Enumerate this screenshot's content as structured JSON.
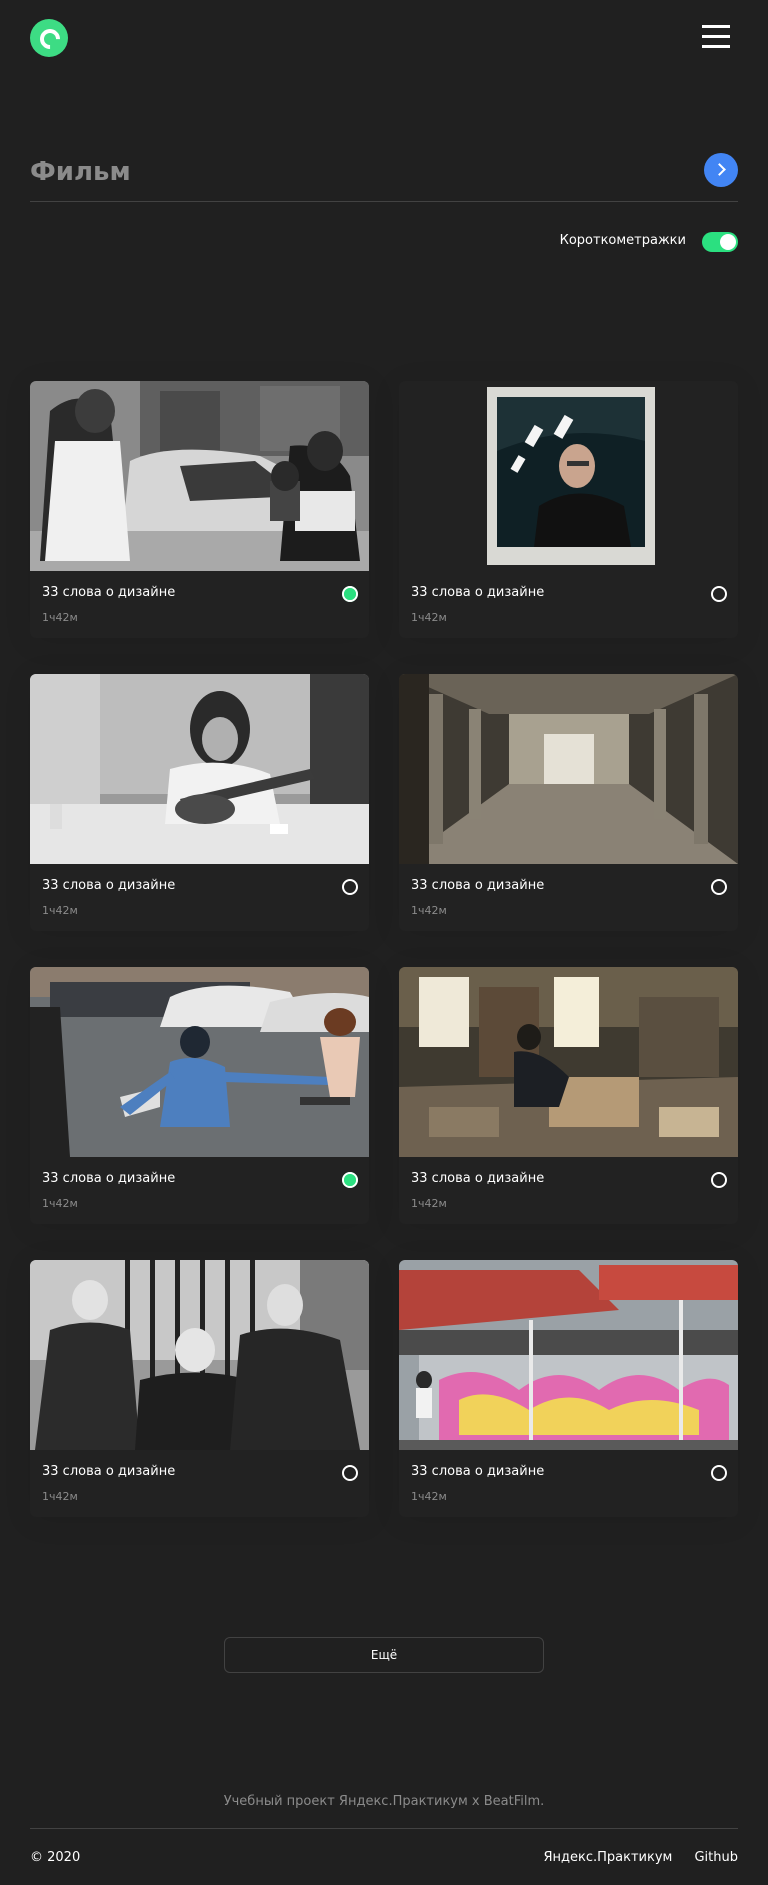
{
  "header": {
    "logo_icon": "c-logo-icon",
    "menu_icon": "hamburger-menu-icon"
  },
  "search": {
    "placeholder": "Фильм",
    "submit_icon": "chevron-right-icon"
  },
  "filter": {
    "label": "Короткометражки",
    "enabled": true
  },
  "movies": [
    {
      "title": "33 слова о дизайне",
      "duration": "1ч42м",
      "saved": true
    },
    {
      "title": "33 слова о дизайне",
      "duration": "1ч42м",
      "saved": false
    },
    {
      "title": "33 слова о дизайне",
      "duration": "1ч42м",
      "saved": false
    },
    {
      "title": "33 слова о дизайне",
      "duration": "1ч42м",
      "saved": false
    },
    {
      "title": "33 слова о дизайне",
      "duration": "1ч42м",
      "saved": true
    },
    {
      "title": "33 слова о дизайне",
      "duration": "1ч42м",
      "saved": false
    },
    {
      "title": "33 слова о дизайне",
      "duration": "1ч42м",
      "saved": false
    },
    {
      "title": "33 слова о дизайне",
      "duration": "1ч42м",
      "saved": false
    }
  ],
  "more_label": "Ещё",
  "footer": {
    "description": "Учебный проект Яндекс.Практикум х BeatFilm.",
    "copyright": "© 2020",
    "links": [
      "Яндекс.Практикум",
      "Github"
    ]
  },
  "colors": {
    "accent_green": "#2be080",
    "accent_blue": "#4285f4",
    "background": "#202020"
  }
}
